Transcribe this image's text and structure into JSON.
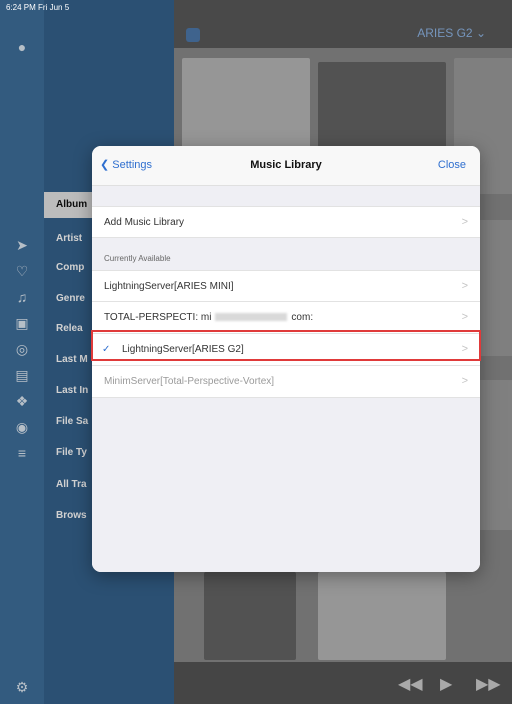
{
  "status_bar": {
    "time_date": "6:24 PM  Fri Jun 5"
  },
  "header": {
    "device_name": "ARIES G2 ⌄"
  },
  "side_menu": {
    "selected": "Album",
    "items": [
      "Artist",
      "Comp",
      "Genre",
      "Relea",
      "Last M",
      "Last In",
      "File Sa",
      "File Ty",
      "All Tra",
      "Brows"
    ]
  },
  "modal": {
    "back_label": "Settings",
    "title": "Music Library",
    "close_label": "Close",
    "add_library_label": "Add Music Library",
    "section_label": "Currently Available",
    "libraries": [
      {
        "label": "LightningServer[ARIES MINI]"
      },
      {
        "label_start": "TOTAL-PERSPECTI: mi",
        "label_end": "com:"
      },
      {
        "label": "LightningServer[ARIES G2]",
        "selected": true
      },
      {
        "label": "MinimServer[Total-Perspective-Vortex]",
        "disabled": true
      }
    ],
    "chevron": ">"
  },
  "colors": {
    "accent": "#2f6fcf",
    "highlight_border": "#e03a3a",
    "menu_bg": "#35628d"
  },
  "icons": [
    "user-icon",
    "arrow-right-circle-icon",
    "heart-icon",
    "playlist-icon",
    "library-icon",
    "radio-icon",
    "device-icon",
    "tidal-icon",
    "qobuz-icon",
    "equalizer-icon",
    "settings-icon",
    "checkmark-icon",
    "chevron-right-icon"
  ]
}
